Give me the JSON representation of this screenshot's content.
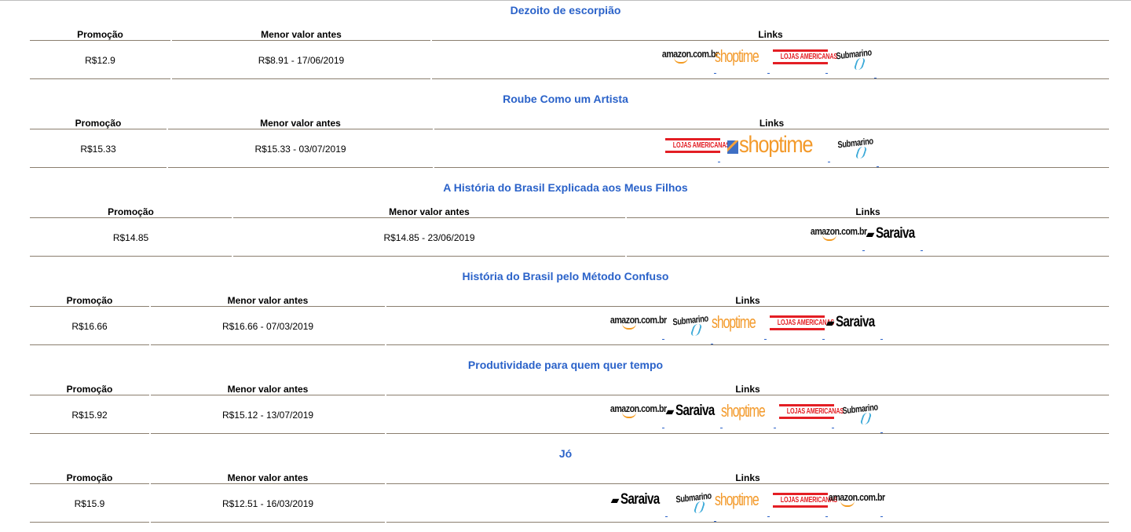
{
  "blocks": [
    {
      "title": "Dezoito de escorpião",
      "headers": {
        "promo": "Promoção",
        "menor": "Menor valor antes",
        "links": "Links"
      },
      "promo": "R$12.9",
      "menor": "R$8.91 - 17/06/2019",
      "stores": [
        "amazon",
        "shoptime",
        "lojas",
        "submarino"
      ]
    },
    {
      "title": "Roube Como um Artista",
      "headers": {
        "promo": "Promoção",
        "menor": "Menor valor antes",
        "links": "Links"
      },
      "promo": "R$15.33",
      "menor": "R$15.33 - 03/07/2019",
      "stores": [
        "lojas",
        "shoptime",
        "submarino"
      ]
    },
    {
      "title": "A História do Brasil Explicada aos Meus Filhos",
      "headers": {
        "promo": "Promoção",
        "menor": "Menor valor antes",
        "links": "Links"
      },
      "promo": "R$14.85",
      "menor": "R$14.85 - 23/06/2019",
      "stores": [
        "amazon",
        "saraiva"
      ]
    },
    {
      "title": "História do Brasil pelo Método Confuso",
      "headers": {
        "promo": "Promoção",
        "menor": "Menor valor antes",
        "links": "Links"
      },
      "promo": "R$16.66",
      "menor": "R$16.66 - 07/03/2019",
      "stores": [
        "amazon",
        "submarino",
        "shoptime",
        "lojas",
        "saraiva"
      ]
    },
    {
      "title": "Produtividade para quem quer tempo",
      "headers": {
        "promo": "Promoção",
        "menor": "Menor valor antes",
        "links": "Links"
      },
      "promo": "R$15.92",
      "menor": "R$15.12 - 13/07/2019",
      "stores": [
        "amazon",
        "saraiva",
        "shoptime",
        "lojas",
        "submarino"
      ]
    },
    {
      "title": "Jó",
      "headers": {
        "promo": "Promoção",
        "menor": "Menor valor antes",
        "links": "Links"
      },
      "promo": "R$15.9",
      "menor": "R$12.51 - 16/03/2019",
      "stores": [
        "saraiva",
        "submarino",
        "shoptime",
        "lojas",
        "amazon"
      ]
    }
  ],
  "store_labels": {
    "amazon": "amazon.com.br",
    "shoptime": "shoptime",
    "lojas": "LOJAS AMERICANAS",
    "submarino": "Submarino",
    "saraiva": "Saraiva"
  },
  "colors": {
    "title": "#2a62c9",
    "rule": "#8a7e6e"
  }
}
